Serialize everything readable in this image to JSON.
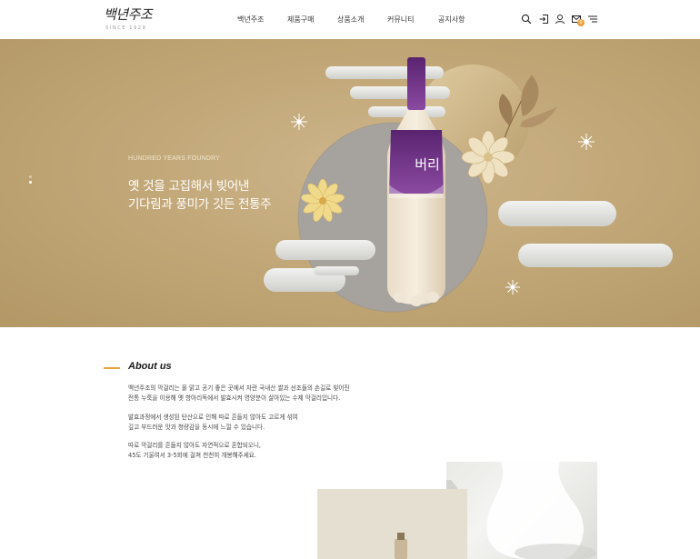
{
  "brand": {
    "logo_text": "백년주조",
    "logo_sub": "SINCE 1929"
  },
  "nav": {
    "items": [
      {
        "label": "백년주조"
      },
      {
        "label": "제품구매"
      },
      {
        "label": "상품소개"
      },
      {
        "label": "커뮤니티"
      },
      {
        "label": "공지사항"
      }
    ]
  },
  "header_icons": [
    "search-icon",
    "login-icon",
    "user-icon",
    "cart-icon",
    "menu-icon"
  ],
  "cart_count": "0",
  "hero": {
    "eyebrow": "HUNDRED YEARS FOUNDRY",
    "headline_1": "옛 것을 고집해서 빚어낸",
    "headline_2": "기다림과 풍미가 깃든 전통주",
    "bottle_label": "버리",
    "slide_count": 2,
    "active_slide": 1
  },
  "about": {
    "title": "About us",
    "p1_line1": "백년주조의 막걸리는 물 맑고 공기 좋은 곳에서 자란 국내산 쌀과 선조들의 손길로 빚어진",
    "p1_line2": "전통 누룩을 이용해 옛 항아리독에서 발효시켜 영양분이 살아있는 수제 막걸리입니다.",
    "p2_line1": "발효과정에서 생성된 탄산으로 인해 따로 흔들지 않아도 고르게 섞여",
    "p2_line2": "깊고 부드러운 맛과 청량감을 동시에 느낄 수 있습니다.",
    "p3_line1": "따로 막걸리를 흔들지 않아도 자연적으로 혼합되오니,",
    "p3_line2": "45도 기울여서 3-5회에 걸쳐 천천히 개봉해주세요."
  },
  "colors": {
    "accent": "#e6a23c",
    "hero_bg": "#c2a878",
    "bottle_purple": "#6b2c7e"
  }
}
